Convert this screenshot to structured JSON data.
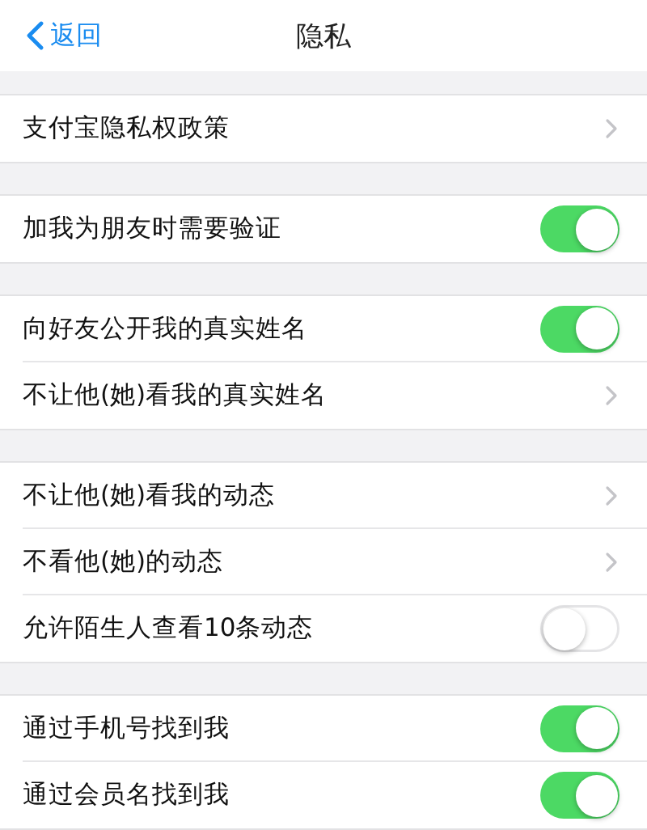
{
  "nav_bar": {
    "back": "返回",
    "title": "隐私"
  },
  "sections": [
    {
      "rows": [
        {
          "kind": "link",
          "label": "支付宝隐私权政策"
        }
      ]
    },
    {
      "rows": [
        {
          "kind": "toggle",
          "label": "加我为朋友时需要验证",
          "on": true
        }
      ]
    },
    {
      "rows": [
        {
          "kind": "toggle",
          "label": "向好友公开我的真实姓名",
          "on": true
        },
        {
          "kind": "link",
          "label": "不让他(她)看我的真实姓名"
        }
      ]
    },
    {
      "rows": [
        {
          "kind": "link",
          "label": "不让他(她)看我的动态"
        },
        {
          "kind": "link",
          "label": "不看他(她)的动态"
        },
        {
          "kind": "toggle",
          "label": "允许陌生人查看10条动态",
          "on": false
        }
      ]
    },
    {
      "rows": [
        {
          "kind": "toggle",
          "label": "通过手机号找到我",
          "on": true
        },
        {
          "kind": "toggle",
          "label": "通过会员名找到我",
          "on": true
        }
      ]
    }
  ]
}
